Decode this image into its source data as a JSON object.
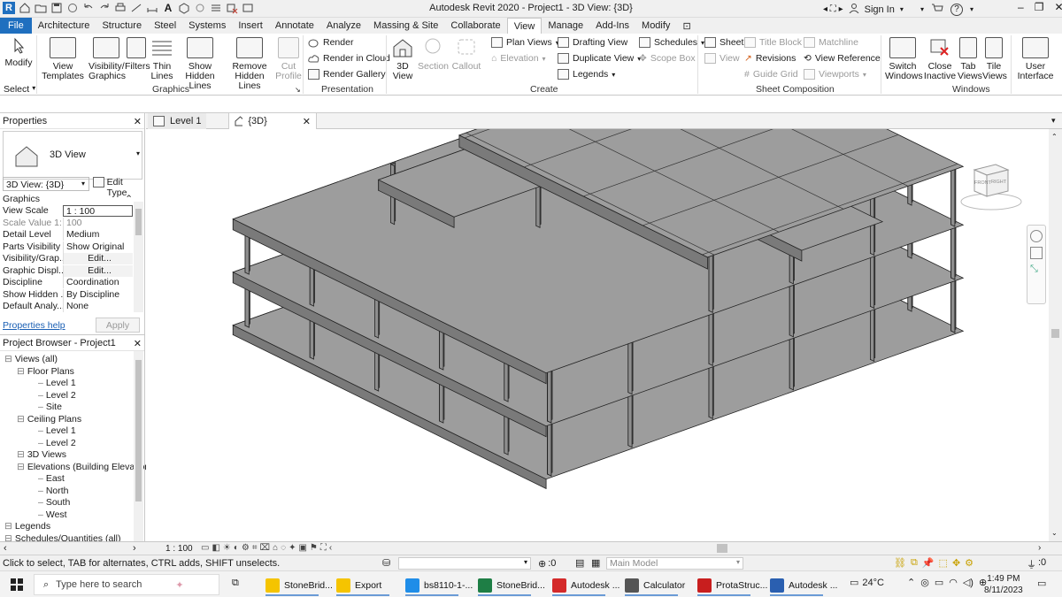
{
  "app": {
    "title": "Autodesk Revit 2020 - Project1 - 3D View: {3D}",
    "sign_in": "Sign In"
  },
  "tabs": [
    "File",
    "Architecture",
    "Structure",
    "Steel",
    "Systems",
    "Insert",
    "Annotate",
    "Analyze",
    "Massing & Site",
    "Collaborate",
    "View",
    "Manage",
    "Add-Ins",
    "Modify"
  ],
  "active_tab": "View",
  "ribbon": {
    "modify": "Modify",
    "select": "Select",
    "graphics": {
      "label": "Graphics",
      "view_templates": "View Templates",
      "visibility": "Visibility/ Graphics",
      "filters": "Filters",
      "thin_lines": "Thin Lines",
      "show_hidden": "Show Hidden Lines",
      "remove_hidden": "Remove Hidden Lines",
      "cut_profile": "Cut Profile"
    },
    "presentation": {
      "label": "Presentation",
      "render": "Render",
      "render_cloud": "Render in Cloud",
      "render_gallery": "Render Gallery"
    },
    "create": {
      "label": "Create",
      "view3d": "3D View",
      "section": "Section",
      "callout": "Callout",
      "plan_views": "Plan Views",
      "elevation": "Elevation",
      "drafting_view": "Drafting View",
      "duplicate_view": "Duplicate View",
      "legends": "Legends",
      "schedules": "Schedules",
      "scope_box": "Scope Box"
    },
    "sheet": {
      "label": "Sheet Composition",
      "sheet": "Sheet",
      "view": "View",
      "title_block": "Title Block",
      "revisions": "Revisions",
      "guide_grid": "Guide Grid",
      "matchline": "Matchline",
      "view_reference": "View Reference",
      "viewports": "Viewports"
    },
    "windows": {
      "label": "Windows",
      "switch": "Switch Windows",
      "close": "Close Inactive",
      "tab": "Tab Views",
      "tile": "Tile Views",
      "user_interface": "User Interface"
    }
  },
  "properties": {
    "title": "Properties",
    "type_name": "3D View",
    "instance": "3D View: {3D}",
    "edit_type": "Edit Type",
    "section": "Graphics",
    "rows": [
      {
        "k": "View Scale",
        "v": "1 : 100"
      },
      {
        "k": "Scale Value   1:",
        "v": "100"
      },
      {
        "k": "Detail Level",
        "v": "Medium"
      },
      {
        "k": "Parts Visibility",
        "v": "Show Original"
      },
      {
        "k": "Visibility/Grap...",
        "v": "Edit..."
      },
      {
        "k": "Graphic Displ...",
        "v": "Edit..."
      },
      {
        "k": "Discipline",
        "v": "Coordination"
      },
      {
        "k": "Show Hidden ...",
        "v": "By Discipline"
      },
      {
        "k": "Default Analy...",
        "v": "None"
      }
    ],
    "help": "Properties help",
    "apply": "Apply"
  },
  "browser": {
    "title": "Project Browser - Project1",
    "items": [
      {
        "t": "Views (all)",
        "lvl": 0
      },
      {
        "t": "Floor Plans",
        "lvl": 1
      },
      {
        "t": "Level 1",
        "lvl": 2
      },
      {
        "t": "Level 2",
        "lvl": 2
      },
      {
        "t": "Site",
        "lvl": 2
      },
      {
        "t": "Ceiling Plans",
        "lvl": 1
      },
      {
        "t": "Level 1",
        "lvl": 2
      },
      {
        "t": "Level 2",
        "lvl": 2
      },
      {
        "t": "3D Views",
        "lvl": 1
      },
      {
        "t": "Elevations (Building Elevation",
        "lvl": 1
      },
      {
        "t": "East",
        "lvl": 2
      },
      {
        "t": "North",
        "lvl": 2
      },
      {
        "t": "South",
        "lvl": 2
      },
      {
        "t": "West",
        "lvl": 2
      },
      {
        "t": "Legends",
        "lvl": 0
      },
      {
        "t": "Schedules/Quantities (all)",
        "lvl": 0
      }
    ]
  },
  "view_tabs": [
    {
      "label": "Level 1"
    },
    {
      "label": "{3D}"
    }
  ],
  "viewcube": {
    "front": "FRONT",
    "right": "RIGHT"
  },
  "view_control": {
    "scale": "1 : 100"
  },
  "status": {
    "hint": "Click to select, TAB for alternates, CTRL adds, SHIFT unselects.",
    "count": ":0",
    "model": "Main Model",
    "filter": ":0"
  },
  "taskbar": {
    "search": "Type here to search",
    "apps": [
      {
        "label": "StoneBrid...",
        "color": "#f5c400"
      },
      {
        "label": "Export",
        "color": "#f5c400"
      },
      {
        "label": "bs8110-1-...",
        "color": "#1f8de8"
      },
      {
        "label": "StoneBrid...",
        "color": "#1e7e45"
      },
      {
        "label": "Autodesk ...",
        "color": "#d42a2a"
      },
      {
        "label": "Calculator",
        "color": "#555555"
      },
      {
        "label": "ProtaStruc...",
        "color": "#c81e1e"
      },
      {
        "label": "Autodesk ...",
        "color": "#2a5fb0"
      }
    ],
    "weather": "24°C",
    "time": "1:49 PM",
    "date": "8/11/2023"
  }
}
